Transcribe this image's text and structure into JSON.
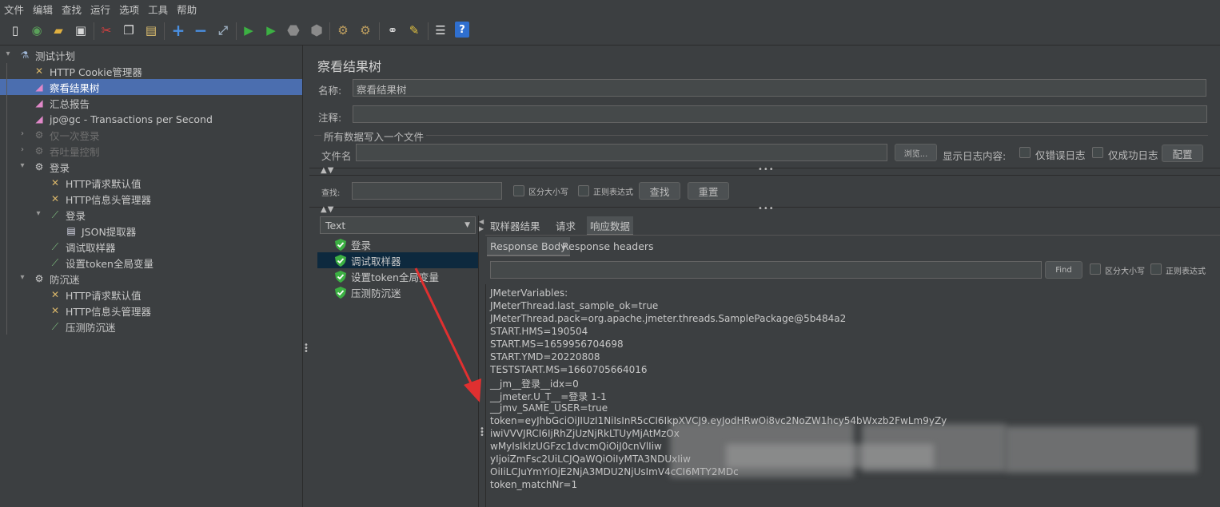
{
  "menu": [
    "文件",
    "编辑",
    "查找",
    "运行",
    "选项",
    "工具",
    "帮助"
  ],
  "toolbar_icons": [
    "new-icon",
    "templates-icon",
    "open-icon",
    "save-icon",
    "cut-icon",
    "copy-icon",
    "paste-icon",
    "expand-icon",
    "collapse-icon",
    "toggle-icon",
    "start-icon",
    "start-no-pause-icon",
    "stop-icon",
    "shutdown-icon",
    "clear-icon",
    "clear-all-icon",
    "search-icon",
    "reset-search-icon",
    "function-helper-icon",
    "help-icon"
  ],
  "tree": {
    "items": [
      {
        "label": "测试计划",
        "icon": "flask-icon"
      },
      {
        "label": "HTTP Cookie管理器",
        "icon": "wrench-icon"
      },
      {
        "label": "察看结果树",
        "icon": "chart-icon"
      },
      {
        "label": "汇总报告",
        "icon": "chart-icon"
      },
      {
        "label": "jp@gc - Transactions per Second",
        "icon": "chart-icon"
      },
      {
        "label": "仅一次登录",
        "icon": "gear-icon"
      },
      {
        "label": "吞吐量控制",
        "icon": "gear-icon"
      },
      {
        "label": "登录",
        "icon": "gear-icon"
      },
      {
        "label": "HTTP请求默认值",
        "icon": "wrench-icon"
      },
      {
        "label": "HTTP信息头管理器",
        "icon": "wrench-icon"
      },
      {
        "label": "登录",
        "icon": "pipette-icon"
      },
      {
        "label": "JSON提取器",
        "icon": "doc-icon"
      },
      {
        "label": "调试取样器",
        "icon": "pipette-icon"
      },
      {
        "label": "设置token全局变量",
        "icon": "pipette-icon"
      },
      {
        "label": "防沉迷",
        "icon": "gear-icon"
      },
      {
        "label": "HTTP请求默认值",
        "icon": "wrench-icon"
      },
      {
        "label": "HTTP信息头管理器",
        "icon": "wrench-icon"
      },
      {
        "label": "压测防沉迷",
        "icon": "pipette-icon"
      }
    ]
  },
  "panel": {
    "title": "察看结果树",
    "name_label": "名称:",
    "name_value": "察看结果树",
    "comment_label": "注释:",
    "comment_value": "",
    "file_section": "所有数据写入一个文件",
    "filename_label": "文件名",
    "filename_value": "",
    "browse": "浏览...",
    "log_label": "显示日志内容:",
    "errors_only": "仅错误日志",
    "success_only": "仅成功日志",
    "configure": "配置",
    "search_label": "查找:",
    "search_value": "",
    "case_sensitive": "区分大小写",
    "regex": "正则表达式",
    "search_btn": "查找",
    "reset_btn": "重置"
  },
  "renderer": {
    "selected": "Text"
  },
  "results": {
    "items": [
      "登录",
      "调试取样器",
      "设置token全局变量",
      "压测防沉迷"
    ],
    "selected_index": 1
  },
  "tabs": {
    "main": [
      "取样器结果",
      "请求",
      "响应数据"
    ],
    "active_main": 2,
    "sub": [
      "Response Body",
      "Response headers"
    ],
    "active_sub": 0
  },
  "find": {
    "button": "Find",
    "case_sensitive": "区分大小写",
    "regex": "正则表达式",
    "value": ""
  },
  "response_lines": [
    "JMeterVariables:",
    "JMeterThread.last_sample_ok=true",
    "JMeterThread.pack=org.apache.jmeter.threads.SamplePackage@5b484a2",
    "START.HMS=190504",
    "START.MS=1659956704698",
    "START.YMD=20220808",
    "TESTSTART.MS=1660705664016",
    "__jm__登录__idx=0",
    "__jmeter.U_T__=登录 1-1",
    "__jmv_SAME_USER=true",
    "token=eyJhbGciOiJIUzI1NiIsInR5cCI6IkpXVCJ9.eyJodHRwOi8vc2NoZW1hcy54bWxzb2FwLm9yZy",
    "iwiVVVJRCI6IjRhZjUzNjRkLTUyMjAtMzOx",
    "wMyIsIklzUGFzc1dvcmQiOiJ0cnVlIiw",
    "yIjoiZmFsc2UiLCJQaWQiOiIyMTA3NDUxIiw",
    "OiIiLCJuYmYiOjE2NjA3MDU2NjUsImV4cCI6MTY2MDc",
    "token_matchNr=1"
  ],
  "response_line_tails": {
    "10": "ZW50aXR5LzlwMDUvMDUvaWRlbnRpdHkvY2xhaW1zL25hbWUiOiJ...lbWUiOiJ",
    "11": "Wltcy9uYW1lIjoiMTUzMzM4MTgwl",
    "12": "wIzMzgxODAiLC2VyTmFtZSI6ImNhaWNhaTA",
    "14": "JNlljoicTEuY29tliwiYXVkIjoiRXZIcnIvbmUifQ",
    "14b": "CoB1iu43eMv_Vqyp_YLIT4ExA"
  },
  "response_line_extras": {
    "11": "CI6Ii",
    "13": "zZWRNc2ci",
    "13b": "AiLCJJZENhc",
    "12": "ZSl6lmNhaWNhaTA",
    "12b": "1SlsIklzVml",
    "13c": "NOZXdVc2V"
  }
}
